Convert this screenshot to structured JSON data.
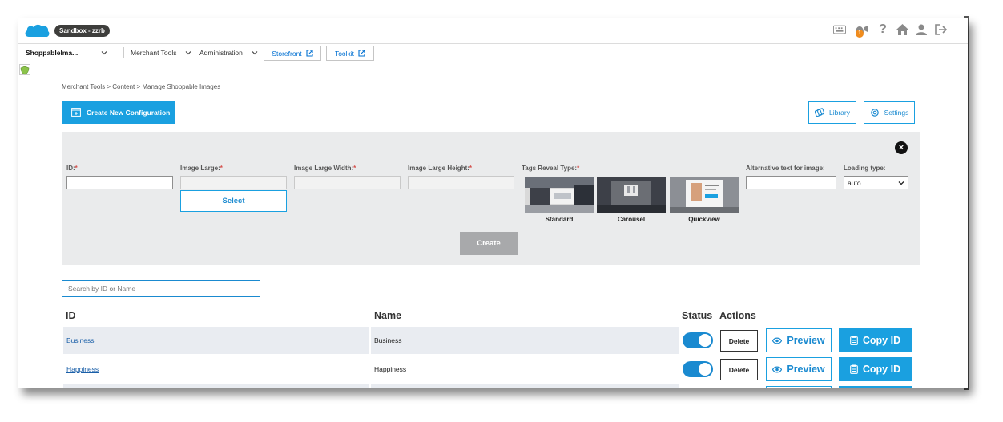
{
  "header": {
    "sandbox_label": "Sandbox - zzrb",
    "brand_color": "#1aa0e0"
  },
  "nav": {
    "site_selector": "ShoppableIma...",
    "merchant_tools": "Merchant Tools",
    "administration": "Administration",
    "storefront": "Storefront",
    "toolkit": "Toolkit"
  },
  "notifications": {
    "badge": "1"
  },
  "page": {
    "breadcrumb": "Merchant Tools > Content > Manage Shoppable Images",
    "create_config": "Create New Configuration",
    "library": "Library",
    "settings": "Settings"
  },
  "form": {
    "id_label": "ID:",
    "image_large_label": "Image Large:",
    "image_large_width_label": "Image Large Width:",
    "image_large_height_label": "Image Large Height:",
    "tags_reveal_label": "Tags Reveal Type:",
    "alt_text_label": "Alternative text for image:",
    "loading_type_label": "Loading type:",
    "required_mark": "*",
    "select_button": "Select",
    "reveal_types": [
      "Standard",
      "Carousel",
      "Quickview"
    ],
    "loading_type_value": "auto",
    "create_button": "Create"
  },
  "search": {
    "placeholder": "Search by ID or Name"
  },
  "table": {
    "headers": {
      "id": "ID",
      "name": "Name",
      "status": "Status",
      "actions": "Actions"
    },
    "rows": [
      {
        "id": "Business",
        "name": "Business",
        "status": true
      },
      {
        "id": "Happiness",
        "name": "Happiness",
        "status": true
      }
    ],
    "delete_label": "Delete",
    "preview_label": "Preview",
    "copy_label": "Copy ID"
  }
}
